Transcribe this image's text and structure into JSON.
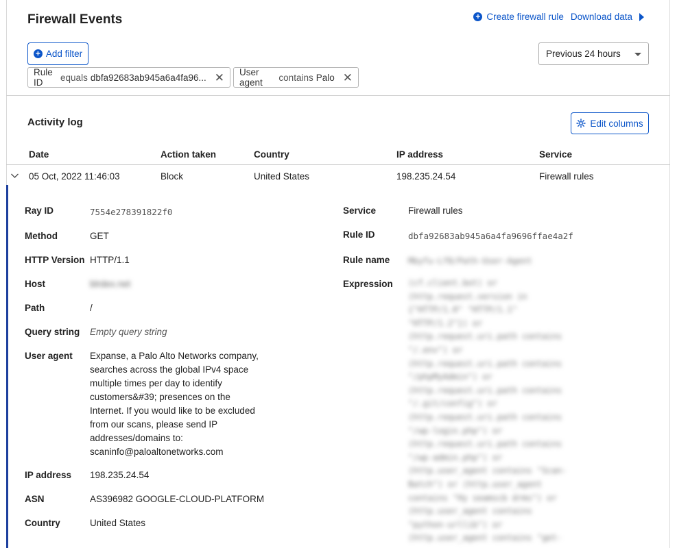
{
  "header": {
    "title": "Firewall Events",
    "create_rule_label": "Create firewall rule",
    "download_label": "Download data"
  },
  "filters": {
    "add_label": "Add filter",
    "time_range": "Previous 24 hours",
    "chips": [
      {
        "field": "Rule ID",
        "op": "equals",
        "value": "dbfa92683ab945a6a4fa96..."
      },
      {
        "field": "User agent",
        "op": "contains",
        "value": "Palo"
      }
    ]
  },
  "activity": {
    "title": "Activity log",
    "edit_columns_label": "Edit columns",
    "columns": [
      "Date",
      "Action taken",
      "Country",
      "IP address",
      "Service"
    ],
    "row": {
      "date": "05 Oct, 2022 11:46:03",
      "action": "Block",
      "country": "United States",
      "ip": "198.235.24.54",
      "service": "Firewall rules"
    }
  },
  "details": {
    "labels": {
      "ray_id": "Ray ID",
      "method": "Method",
      "http_version": "HTTP Version",
      "host": "Host",
      "path": "Path",
      "query": "Query string",
      "user_agent": "User agent",
      "ip": "IP address",
      "asn": "ASN",
      "country": "Country",
      "service": "Service",
      "rule_id": "Rule ID",
      "rule_name": "Rule name",
      "expression": "Expression"
    },
    "values": {
      "ray_id": "7554e278391822f0",
      "method": "GET",
      "http_version": "HTTP/1.1",
      "host": "blrdex.net",
      "path": "/",
      "query": "Empty query string",
      "user_agent": "Expanse, a Palo Alto Networks company, searches across the global IPv4 space multiple times per day to identify customers&#39; presences on the Internet. If you would like to be excluded from our scans, please send IP addresses/domains to: scaninfo@paloaltonetworks.com",
      "ip": "198.235.24.54",
      "asn": "AS396982 GOOGLE-CLOUD-PLATFORM",
      "country": "United States",
      "service": "Firewall rules",
      "rule_id": "dbfa92683ab945a6a4fa9696ffae4a2f",
      "rule_name": "Mbyfu-Lf8/Path-User-Agent",
      "expression": "(cf.client.bot) or\n(http.request.version in\n{\"HTTP/1.0\" \"HTTP/1.1\"\n\"HTTP/1.2\"}) or\n(http.request.uri.path contains\n\"/.env\") or\n(http.request.uri.path contains\n\"/phpMyAdmin\") or\n(http.request.uri.path contains\n\"/.git/config\") or\n(http.request.uri.path contains\n\"/wp-login.php\") or\n(http.request.uri.path contains\n\"/wp-admin.php\") or\n(http.user_agent contains \"Scan-\nBatch\") or (http.user_agent\ncontains \"Hy seamscb drms\") or\n(http.user_agent contains\n\"python-urllib\") or\n(http.user_agent contains \"get-"
    }
  }
}
